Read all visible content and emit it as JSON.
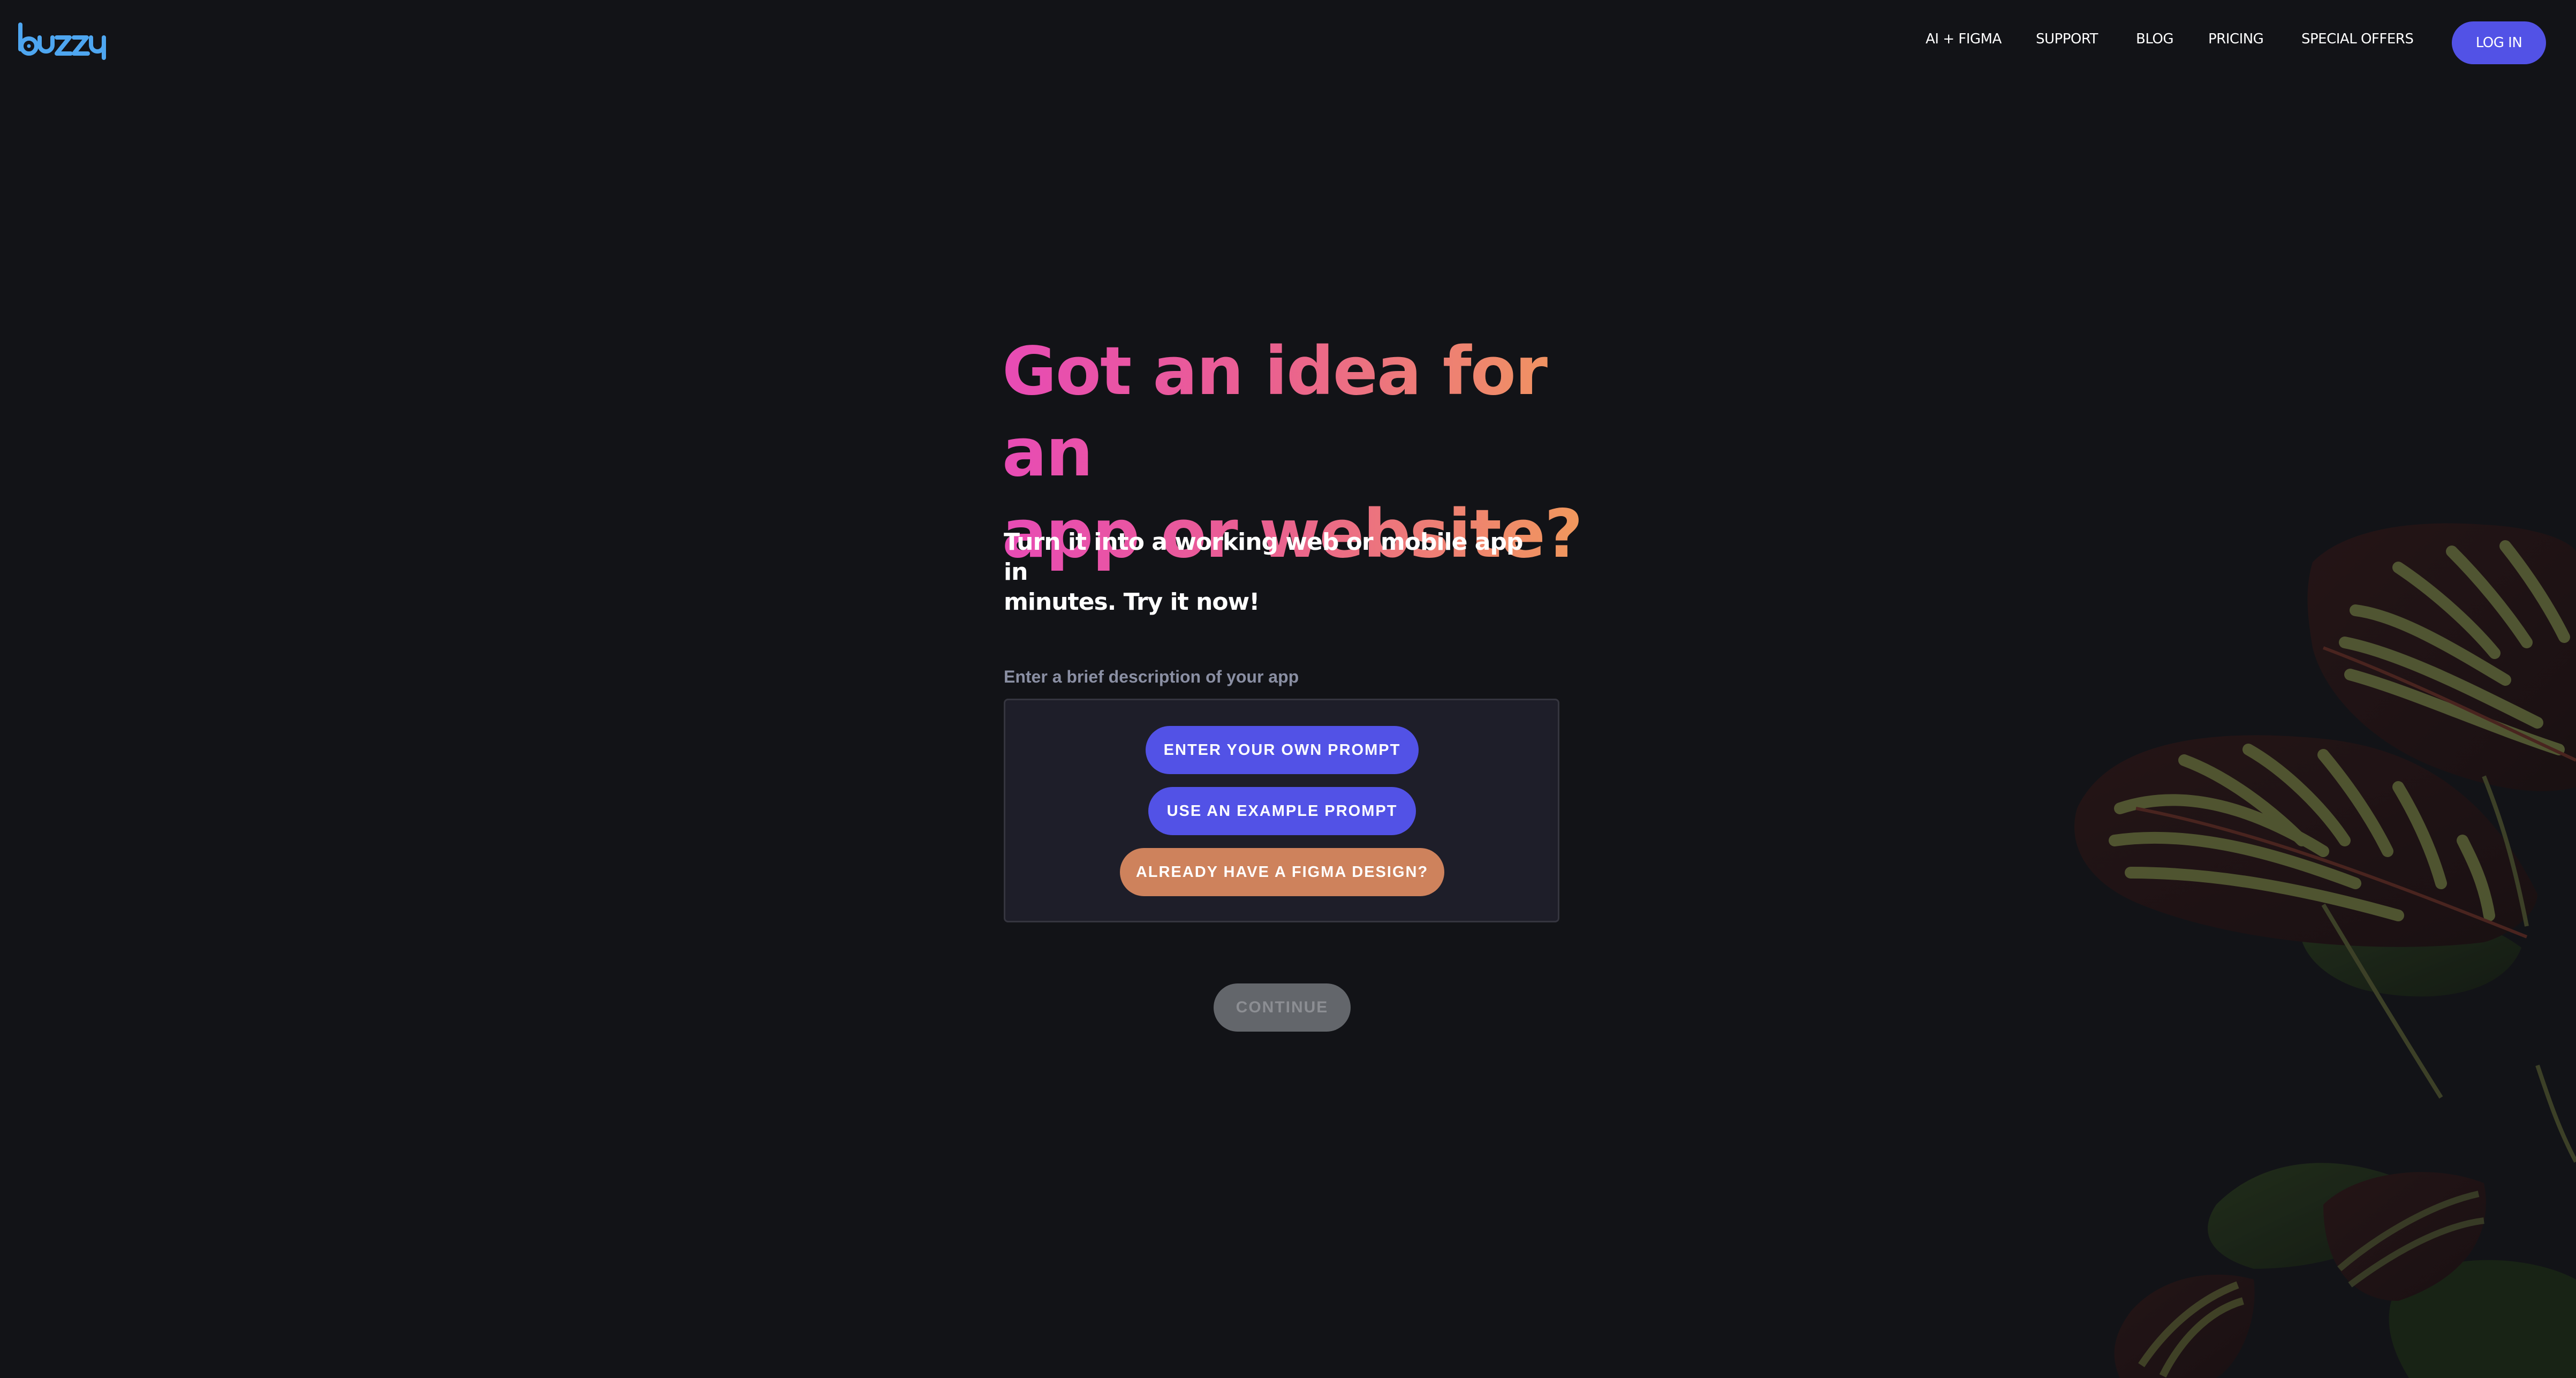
{
  "brand": {
    "logo_text": "buzzy",
    "logo_color": "#4ea6f0"
  },
  "nav": {
    "links": [
      {
        "label": "AI + FIGMA"
      },
      {
        "label": "SUPPORT"
      },
      {
        "label": "BLOG"
      },
      {
        "label": "PRICING"
      },
      {
        "label": "SPECIAL OFFERS"
      }
    ],
    "login_label": "LOG IN"
  },
  "hero": {
    "headline_line1": "Got an idea for an",
    "headline_line2": "app or website?",
    "subtitle_line1": "Turn it into a working web or mobile app in",
    "subtitle_line2": "minutes. Try it now!",
    "gradient_start": "#e84bb5",
    "gradient_end": "#f19a5b"
  },
  "prompt": {
    "label": "Enter a brief description of your app",
    "buttons": {
      "own_prompt": "ENTER YOUR OWN PROMPT",
      "example_prompt": "USE AN EXAMPLE PROMPT",
      "figma_design": "ALREADY HAVE A FIGMA DESIGN?"
    },
    "continue_label": "CONTINUE",
    "continue_disabled": true
  },
  "colors": {
    "background": "#121317",
    "primary": "#5252e6",
    "figma_accent": "#ce825c",
    "disabled": "#63666b"
  },
  "decor": {
    "image": "calathea-plant-leaves"
  }
}
